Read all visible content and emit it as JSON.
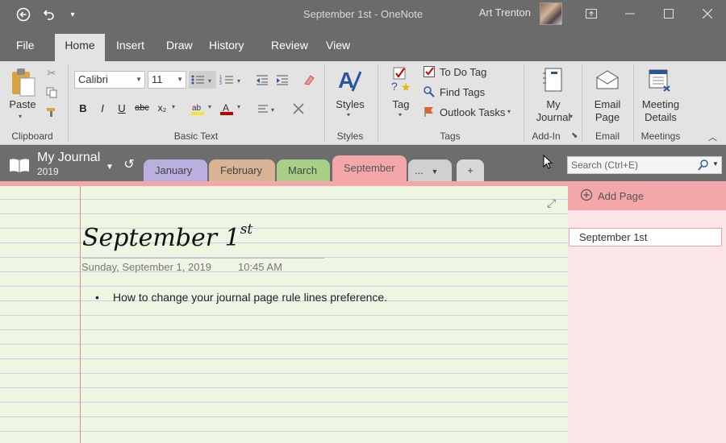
{
  "window": {
    "title": "September 1st  -  OneNote",
    "user_name": "Art Trenton"
  },
  "icons": {
    "back": "back-arrow-icon",
    "undo": "undo-icon",
    "customize": "quick-access-dropdown-icon",
    "restore": "ribbon-display-options-icon",
    "minimize": "minimize-icon",
    "maximize": "maximize-icon",
    "close": "close-icon"
  },
  "menu": {
    "tabs": [
      "File",
      "Home",
      "Insert",
      "Draw",
      "History",
      "Review",
      "View"
    ],
    "active": "Home"
  },
  "ribbon": {
    "clipboard": {
      "paste": "Paste",
      "label": "Clipboard"
    },
    "basic_text": {
      "font": "Calibri",
      "size": "11",
      "bold": "B",
      "italic": "I",
      "underline": "U",
      "strike": "abc",
      "subscript": "x₂",
      "label": "Basic Text"
    },
    "styles": {
      "button": "Styles",
      "label": "Styles"
    },
    "tags": {
      "tag": "Tag",
      "todo": "To Do Tag",
      "find": "Find Tags",
      "outlook": "Outlook Tasks",
      "label": "Tags"
    },
    "addin": {
      "line1": "My",
      "line2": "Journal",
      "label": "Add-In"
    },
    "email": {
      "line1": "Email",
      "line2": "Page",
      "label": "Email"
    },
    "meetings": {
      "line1": "Meeting",
      "line2": "Details",
      "label": "Meetings"
    }
  },
  "notebook": {
    "name": "My Journal",
    "year": "2019",
    "sections": [
      {
        "label": "January",
        "color": "#b9b0e0"
      },
      {
        "label": "February",
        "color": "#d7b493"
      },
      {
        "label": "March",
        "color": "#a7cf86"
      },
      {
        "label": "September",
        "color": "#f4a7a8"
      },
      {
        "label": "...",
        "color": "#d0d0d0"
      }
    ],
    "active_section": "September",
    "add_section": "+",
    "search_placeholder": "Search (Ctrl+E)"
  },
  "page": {
    "title_main": "September 1",
    "title_sup": "st",
    "date": "Sunday, September 1, 2019",
    "time": "10:45 AM",
    "bullet_text": "How to change your journal page rule lines preference."
  },
  "pages_panel": {
    "add_page": "Add Page",
    "pages": [
      "September 1st"
    ]
  }
}
